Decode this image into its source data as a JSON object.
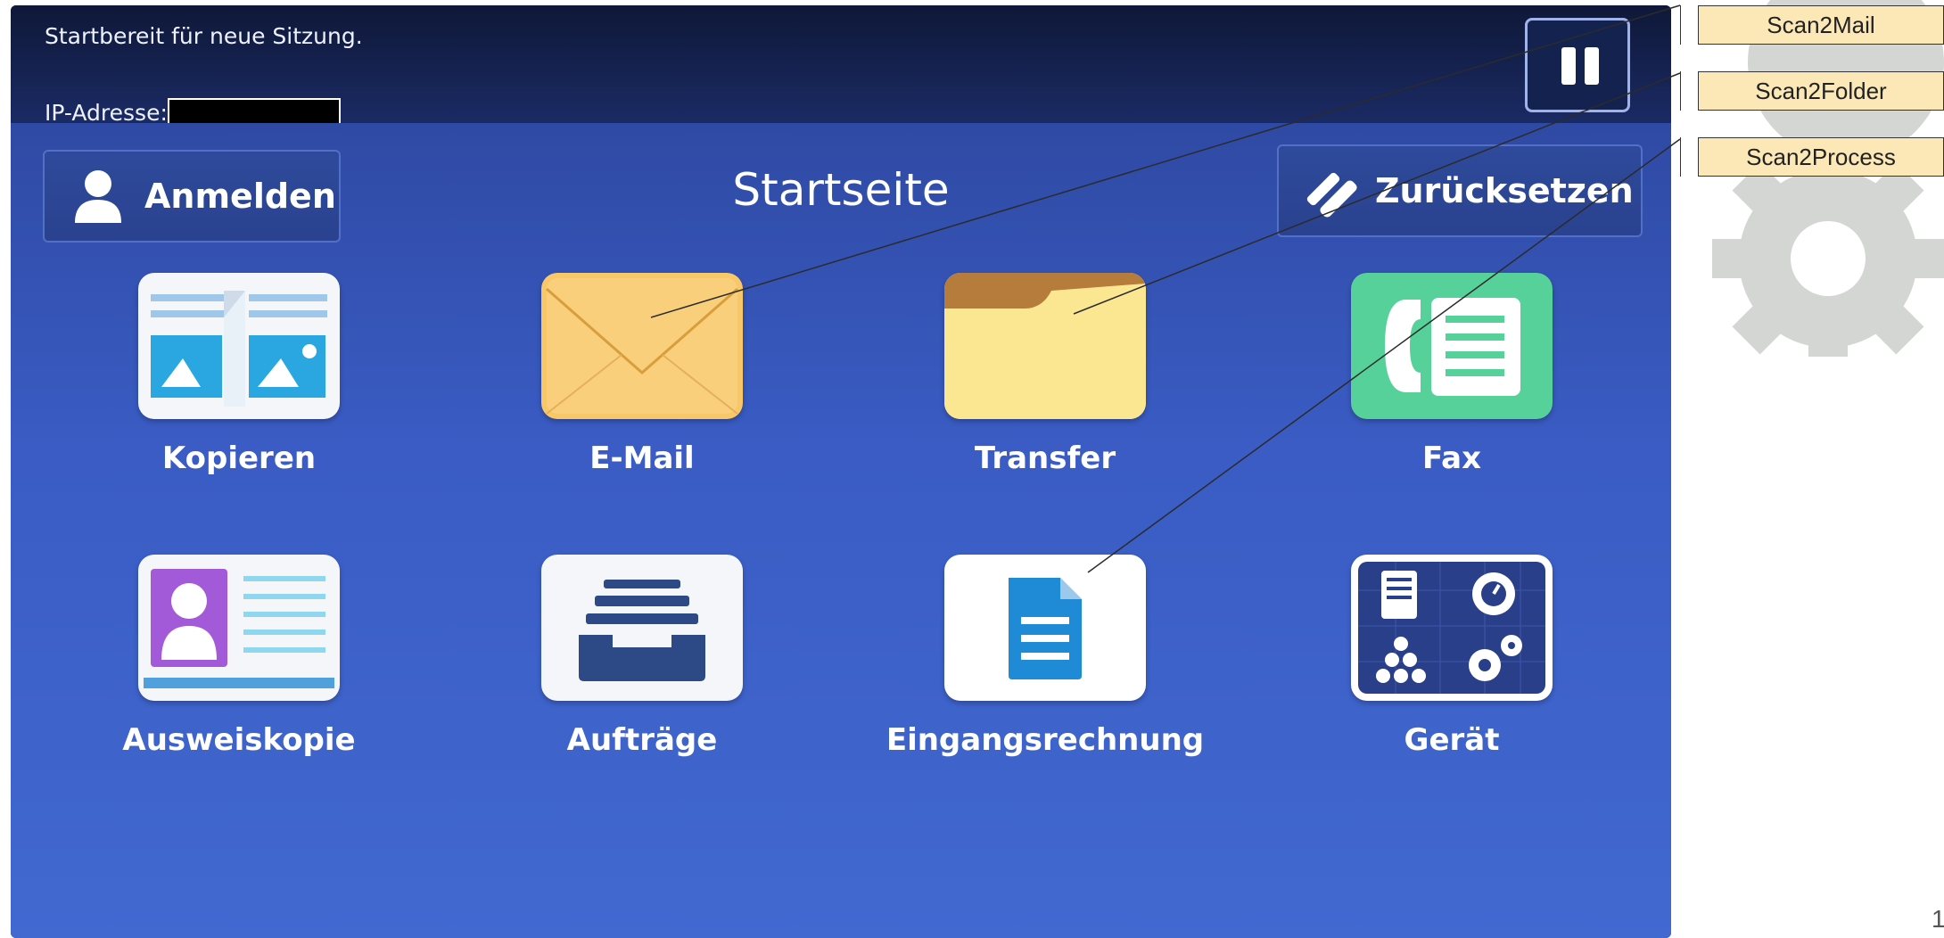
{
  "status": {
    "ready_text": "Startbereit für neue Sitzung.",
    "ip_label": "IP-Adresse:"
  },
  "header": {
    "login_label": "Anmelden",
    "title": "Startseite",
    "reset_label": "Zurücksetzen"
  },
  "tiles": [
    {
      "label": "Kopieren",
      "icon": "copy-icon"
    },
    {
      "label": "E-Mail",
      "icon": "email-envelope-icon"
    },
    {
      "label": "Transfer",
      "icon": "folder-icon"
    },
    {
      "label": "Fax",
      "icon": "fax-icon"
    },
    {
      "label": "Ausweiskopie",
      "icon": "id-card-icon"
    },
    {
      "label": "Aufträge",
      "icon": "job-tray-icon"
    },
    {
      "label": "Eingangsrechnung",
      "icon": "document-icon"
    },
    {
      "label": "Gerät",
      "icon": "device-settings-icon"
    }
  ],
  "callouts": [
    "Scan2Mail",
    "Scan2Folder",
    "Scan2Process"
  ],
  "slide_number": "1",
  "colors": {
    "screen_bg": "#3a5cc4",
    "callout_bg": "#fbe8b6",
    "email_tile": "#f7c768",
    "folder_tile": "#f5d77a",
    "fax_tile": "#57d19a",
    "doc_blue": "#1f8ad6"
  }
}
